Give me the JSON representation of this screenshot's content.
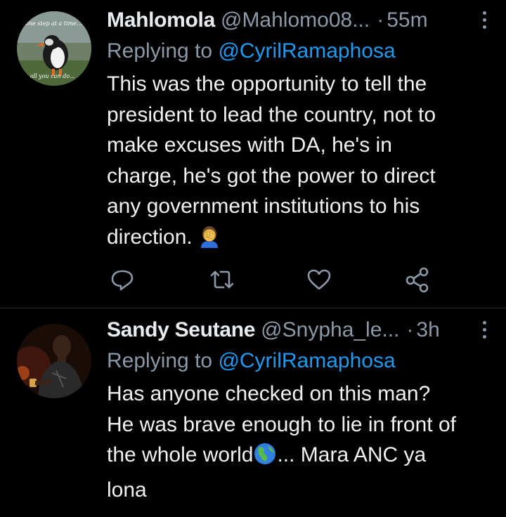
{
  "tweets": [
    {
      "name": "Mahlomola",
      "handle": "@Mahlomo08...",
      "dot": "·",
      "time": "55m",
      "reply_prefix": "Replying to",
      "reply_to": "@CyrilRamaphosa",
      "body_lines": [
        "This was the opportunity to tell the",
        "president to lead the country, not to",
        "make excuses with DA, he's in",
        "charge, he's got the power to direct",
        "any government institutions to his",
        "direction."
      ],
      "emoji": "facepalm-emoji",
      "avatar": {
        "caption_top": "one step at a time...",
        "caption_bottom": "dly all you can do..."
      },
      "actions": [
        "reply-icon",
        "retweet-icon",
        "like-icon",
        "share-icon"
      ]
    },
    {
      "name": "Sandy Seutane",
      "handle": "@Snypha_le...",
      "dot": "·",
      "time": "3h",
      "reply_prefix": "Replying to",
      "reply_to": "@CyrilRamaphosa",
      "body_lines": [
        "Has anyone checked on this man?",
        "He was brave enough to lie in front of",
        "the whole world",
        "... Mara ANC ya",
        "lona"
      ],
      "emoji": "globe-emoji"
    }
  ],
  "colors": {
    "background": "#000000",
    "muted": "#8b98a5",
    "link": "#1d9bf0",
    "divider": "#2f3336"
  }
}
